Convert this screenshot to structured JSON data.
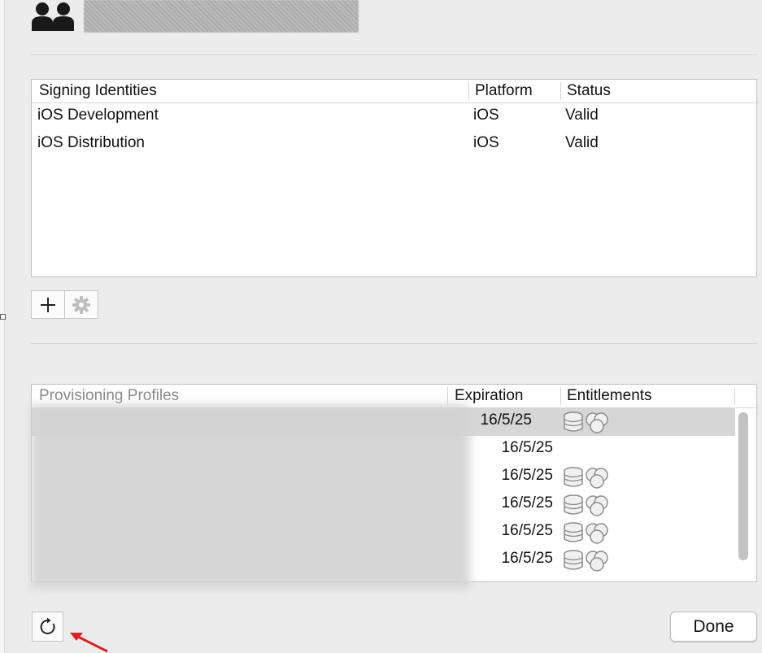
{
  "signing": {
    "columns": [
      "Signing Identities",
      "Platform",
      "Status"
    ],
    "rows": [
      {
        "name": "iOS Development",
        "platform": "iOS",
        "status": "Valid"
      },
      {
        "name": "iOS Distribution",
        "platform": "iOS",
        "status": "Valid"
      }
    ]
  },
  "profiles": {
    "columns": [
      "Provisioning Profiles",
      "Expiration",
      "Entitlements"
    ],
    "rows": [
      {
        "expiration": "16/5/25",
        "entitlements": true,
        "selected": true
      },
      {
        "expiration": "16/5/25",
        "entitlements": false
      },
      {
        "expiration": "16/5/25",
        "entitlements": true
      },
      {
        "expiration": "16/5/25",
        "entitlements": true
      },
      {
        "expiration": "16/5/25",
        "entitlements": true
      },
      {
        "expiration": "16/5/25",
        "entitlements": true
      }
    ]
  },
  "icons": {
    "avatar": "accounts-icon",
    "add": "plus-icon",
    "settings": "gear-icon",
    "refresh": "refresh-icon",
    "entitlements": "entitlements-icon",
    "annotation": "red-arrow"
  },
  "buttons": {
    "done": "Done"
  },
  "colors": {
    "annotation_arrow": "#e02020",
    "selected_row": "#d6d6d6"
  }
}
